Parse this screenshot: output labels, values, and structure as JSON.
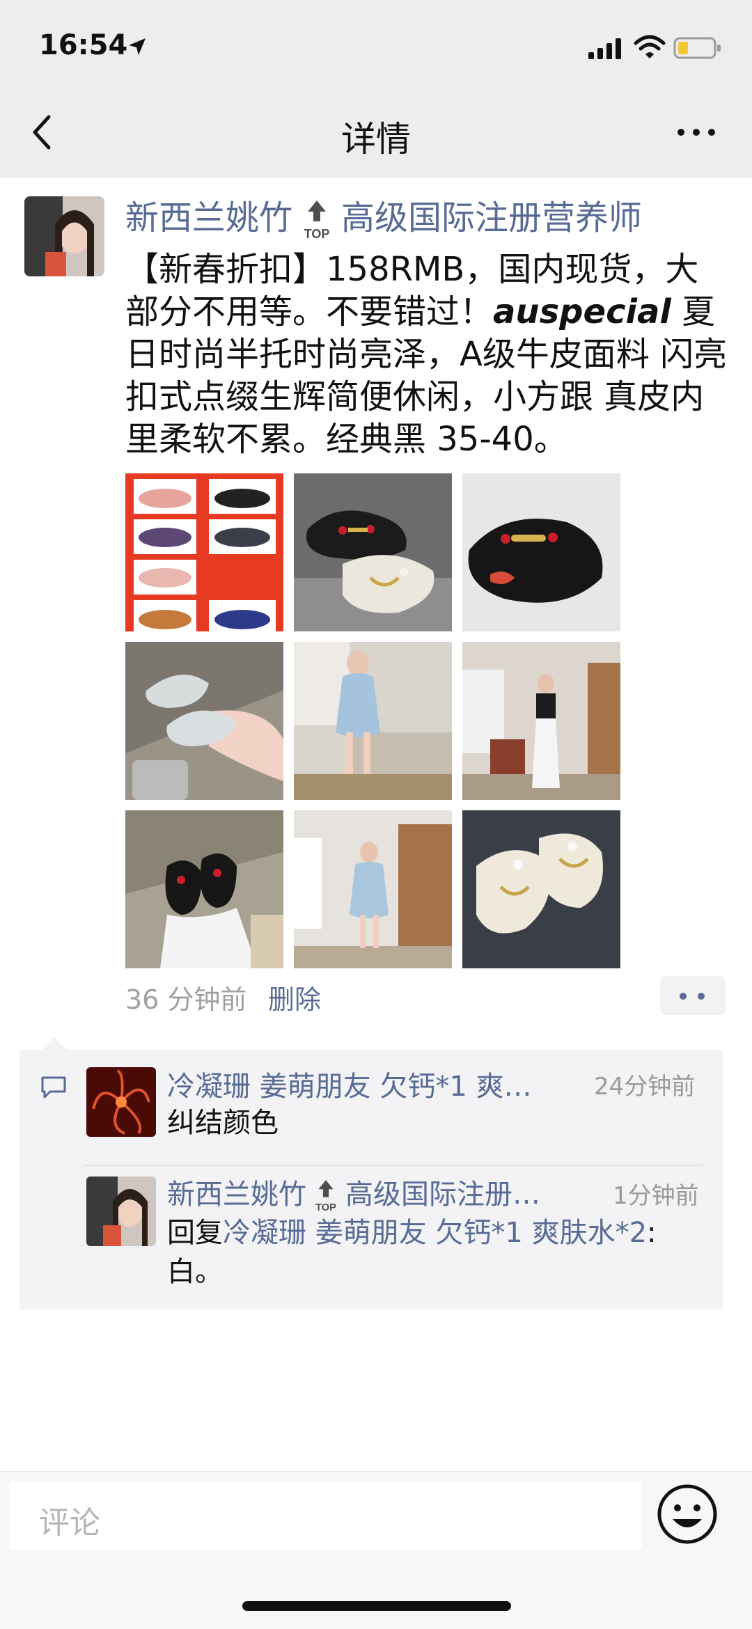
{
  "status_bar": {
    "time": "16:54",
    "icons": [
      "location-arrow-icon",
      "signal-icon",
      "wifi-icon",
      "battery-icon"
    ]
  },
  "nav": {
    "title": "详情",
    "icons": [
      "back-chevron-icon",
      "more-dots-icon"
    ]
  },
  "post": {
    "author": "新西兰姚竹",
    "title_badge": "TOP",
    "author_suffix": "高级国际注册营养师",
    "text_before_brand": "【新春折扣】158RMB，国内现货，大部分不用等。不要错过！",
    "brand": "auspecial",
    "text_after_brand": " 夏日时尚半托时尚亮泽，A级牛皮面料 闪亮扣式点缀生辉简便休闲，小方跟 真皮内里柔软不累。经典黑 35-40。",
    "images": [
      {
        "name": "product-collage"
      },
      {
        "name": "black-and-white-loafers"
      },
      {
        "name": "black-loafer-bee"
      },
      {
        "name": "feet-white-slides"
      },
      {
        "name": "woman-denim-dress-sitting"
      },
      {
        "name": "woman-white-pants-room"
      },
      {
        "name": "feet-black-loafers"
      },
      {
        "name": "woman-denim-dress-standing"
      },
      {
        "name": "white-embroidered-slides"
      }
    ],
    "time_ago": "36 分钟前",
    "delete_label": "删除"
  },
  "comments": [
    {
      "name": "冷凝珊 姜萌朋友 欠钙*1  爽…",
      "time": "24分钟前",
      "text": "纠结颜色"
    },
    {
      "name": "新西兰姚竹",
      "badge": "TOP",
      "name_suffix": "高级国际注册…",
      "time": "1分钟前",
      "reply_prefix": "回复",
      "reply_to": "冷凝珊 姜萌朋友 欠钙*1  爽肤水*2",
      "reply_text": ":白。"
    }
  ],
  "composer": {
    "placeholder": "评论",
    "emoji_icon": "emoji-icon"
  },
  "colors": {
    "link": "#576b95",
    "topbar_bg": "#ededed",
    "comment_bg": "#f3f3f5"
  }
}
